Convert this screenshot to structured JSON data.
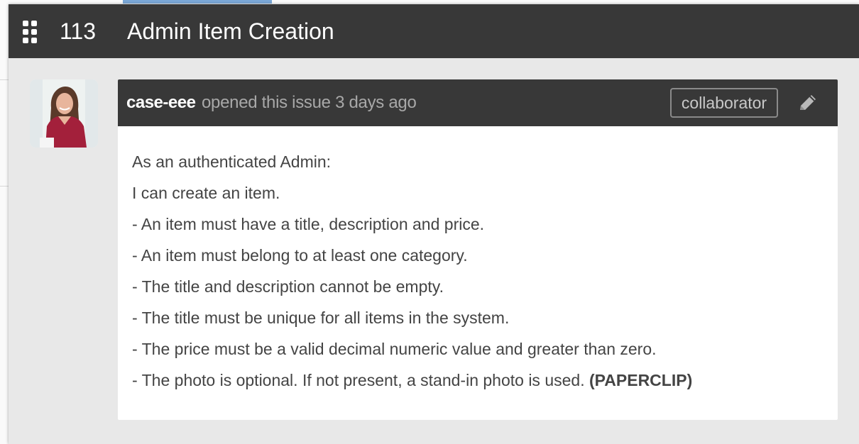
{
  "modal": {
    "issue_number": "113",
    "title": "Admin Item Creation",
    "menu_icon": "grid-icon"
  },
  "comment": {
    "author": "case-eee",
    "meta": "opened this issue 3 days ago",
    "role_badge": "collaborator",
    "edit_icon": "pencil-icon",
    "avatar_icon": "avatar-photo",
    "body": {
      "line1": "As an authenticated Admin:",
      "line2": "I can create an item.",
      "line3": "- An item must have a title, description and price.",
      "line4": "- An item must belong to at least one category.",
      "line5": "- The title and description cannot be empty.",
      "line6": "- The title must be unique for all items in the system.",
      "line7": "- The price must be a valid decimal numeric value and greater than zero.",
      "line8": "- The photo is optional. If not present, a stand-in photo is used.",
      "line8_bold": "(PAPERCLIP)"
    }
  },
  "colors": {
    "header_bg": "#383838",
    "modal_bg": "#e8e8e8",
    "body_text": "#444444",
    "meta_text": "#a8a8a8"
  }
}
